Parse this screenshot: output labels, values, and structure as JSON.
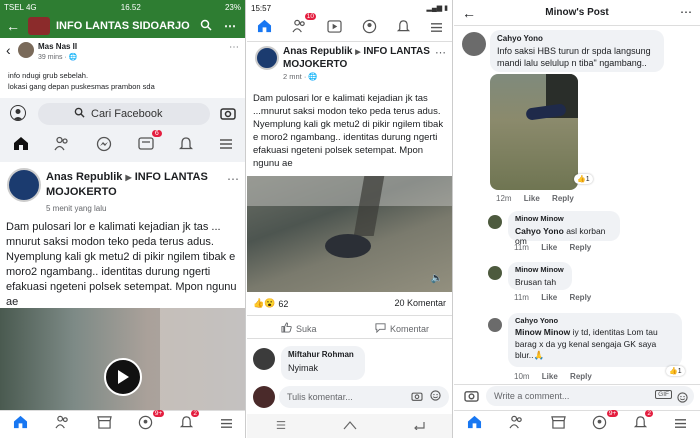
{
  "p1": {
    "status": {
      "carrier": "TSEL",
      "network": "4G",
      "time": "16.52",
      "battery": "23%"
    },
    "group_header": {
      "title": "INFO LANTAS SIDOARJO"
    },
    "comment": {
      "author": "Mas Nas II",
      "time": "39 mins",
      "lines": [
        "info ndugi grub sebelah.",
        "lokasi gang depan puskesmas prambon sda"
      ]
    },
    "search_placeholder": "Cari Facebook",
    "notif_badge": "6",
    "post": {
      "author": "Anas Republik",
      "arrow": "▶",
      "group": "INFO LANTAS MOJOKERTO",
      "time": "5 menit yang lalu",
      "text": "Dam pulosari lor e kalimati kejadian jk tas ... mnurut saksi modon teko peda terus adus. Nyemplung kali gk metu2 di pikir ngilem tibak e moro2 ngambang.. identitas durung ngerti efakuasi ngeteni polsek setempat. Mpon ngunu ae"
    },
    "bottom_badges": {
      "a": "9+",
      "b": "2"
    }
  },
  "p2": {
    "status": {
      "time": "15:57"
    },
    "top_badge": "10",
    "post": {
      "author": "Anas Republik",
      "arrow": "▶",
      "group": "INFO LANTAS MOJOKERTO",
      "time": "2 mnt",
      "text": "Dam pulosari lor e kalimati kejadian jk tas ...mnurut saksi modon teko peda terus adus. Nyemplung kali gk metu2 di pikir ngilem tibak e moro2 ngambang.. identitas durung ngerti efakuasi ngeteni polsek setempat. Mpon ngunu ae"
    },
    "reactions": {
      "count": "62",
      "comments": "20 Komentar"
    },
    "actions": {
      "like": "Suka",
      "comment": "Komentar"
    },
    "comment": {
      "author": "Miftahur Rohman",
      "text": "Nyimak"
    },
    "comment_placeholder": "Tulis komentar..."
  },
  "p3": {
    "title": "Minow's Post",
    "comments": [
      {
        "author": "Cahyo Yono",
        "text": "Info saksi HBS  turun dr spda langsung mandi lalu selulup n tiba\" ngambang..",
        "time": "12m",
        "like": "Like",
        "reply": "Reply",
        "reaction_count": "1"
      },
      {
        "author": "Minow Minow",
        "mention": "Cahyo Yono",
        "text": "asl korban om",
        "time": "11m",
        "like": "Like",
        "reply": "Reply"
      },
      {
        "author": "Minow Minow",
        "text": "Brusan tah",
        "time": "11m",
        "like": "Like",
        "reply": "Reply"
      },
      {
        "author": "Cahyo Yono",
        "mention": "Minow Minow",
        "text": "iy td, identitas Lom tau barag x da yg kenal sengaja GK saya blur..",
        "emoji": "🙏",
        "time": "10m",
        "like": "Like",
        "reply": "Reply",
        "reaction_count": "1"
      }
    ],
    "write_placeholder": "Write a comment...",
    "gif_label": "GIF",
    "bottom_badges": {
      "a": "9+",
      "b": "2"
    }
  },
  "colors": {
    "fb_blue": "#1877f2",
    "green": "#2e7d32",
    "badge_red": "#e41e3f"
  }
}
